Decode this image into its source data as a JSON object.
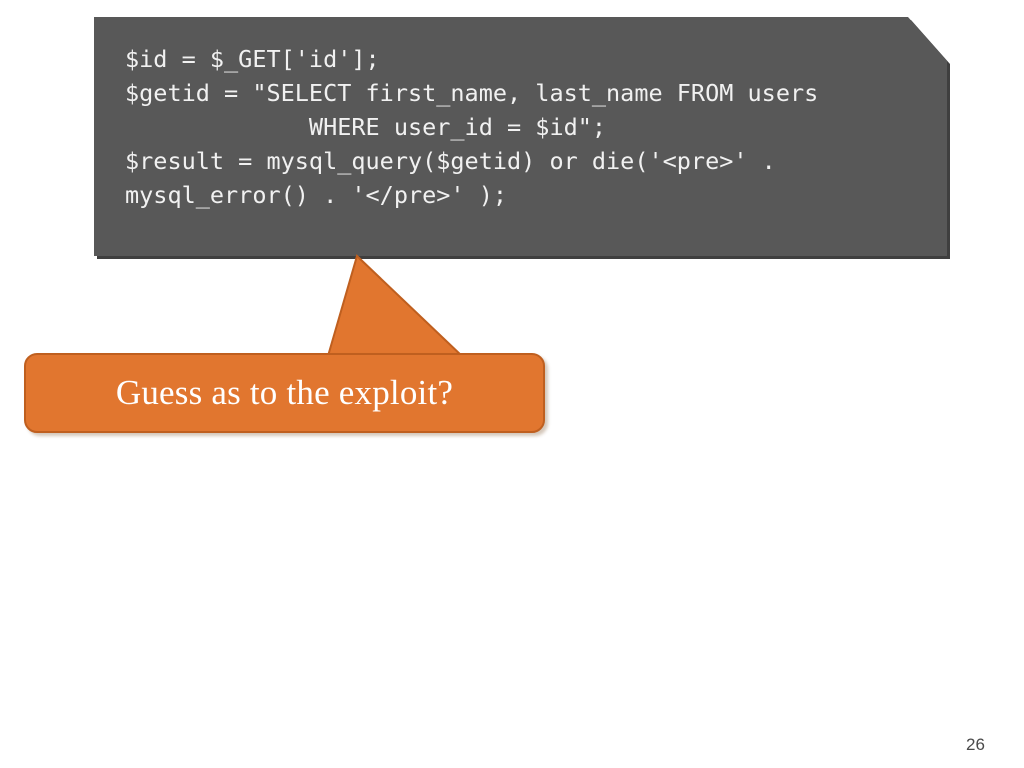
{
  "slide": {
    "background_color": "#ffffff",
    "page_number": "26"
  },
  "code_box": {
    "background_color": "#585858",
    "text_color": "#f1f1f1",
    "shape": "snip-single-corner-rectangle",
    "code": "$id = $_GET['id'];\n$getid = \"SELECT first_name, last_name FROM users\n             WHERE user_id = $id\";\n$result = mysql_query($getid) or die('<pre>' .\nmysql_error() . '</pre>' );"
  },
  "callout": {
    "label": "Guess as to the exploit?",
    "fill_color": "#E1762F",
    "border_color": "#BF5F1F",
    "text_color": "#ffffff",
    "tail_direction": "up-right"
  }
}
